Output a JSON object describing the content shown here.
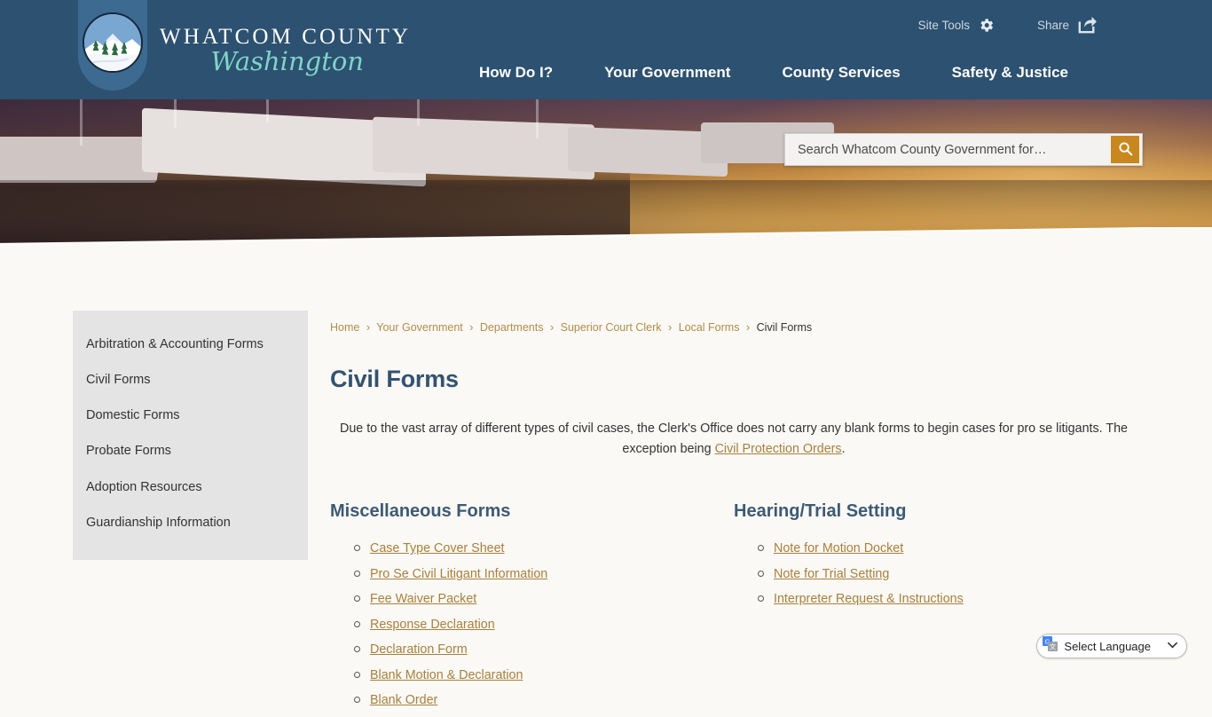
{
  "header": {
    "brand_line1": "WHATCOM COUNTY",
    "brand_line2": "Washington",
    "logo_icon": "whatcom-county-mountain-seal",
    "utility": [
      {
        "label": "Site Tools",
        "icon": "gear-icon"
      },
      {
        "label": "Share",
        "icon": "share-icon"
      }
    ],
    "nav": [
      {
        "label": "How Do I?"
      },
      {
        "label": "Your Government"
      },
      {
        "label": "County Services"
      },
      {
        "label": "Safety & Justice"
      }
    ],
    "colors": {
      "header_bg": "#2d5170",
      "logo_plate": "#3d6a91",
      "brand_accent": "#7fd4c8"
    }
  },
  "search": {
    "placeholder": "Search Whatcom County Government for…",
    "value": "",
    "button_icon": "search-icon",
    "button_color": "#c8881f"
  },
  "banner": {
    "alt": "marina-boats-at-sunset"
  },
  "sidebar": {
    "items": [
      {
        "label": "Arbitration & Accounting Forms"
      },
      {
        "label": "Civil Forms"
      },
      {
        "label": "Domestic Forms"
      },
      {
        "label": "Probate Forms"
      },
      {
        "label": "Adoption Resources"
      },
      {
        "label": "Guardianship Information"
      }
    ]
  },
  "breadcrumb": {
    "separator": "›",
    "items": [
      {
        "label": "Home",
        "current": false
      },
      {
        "label": "Your Government",
        "current": false
      },
      {
        "label": "Departments",
        "current": false
      },
      {
        "label": "Superior Court Clerk",
        "current": false
      },
      {
        "label": "Local Forms",
        "current": false
      },
      {
        "label": "Civil Forms",
        "current": true
      }
    ]
  },
  "main": {
    "title": "Civil Forms",
    "intro_before": "Due to the vast array of different types of civil cases, the Clerk's Office does not carry any blank forms to begin cases for pro se litigants. The exception being ",
    "intro_link": "Civil Protection Orders",
    "intro_after": ".",
    "columns": [
      {
        "title": "Miscellaneous Forms",
        "links": [
          "Case Type Cover Sheet",
          "Pro Se Civil Litigant Information",
          "Fee Waiver Packet",
          "Response Declaration",
          "Declaration Form",
          "Blank Motion & Declaration",
          "Blank Order"
        ]
      },
      {
        "title": "Hearing/Trial Setting",
        "links": [
          "Note for Motion Docket",
          "Note for Trial Setting",
          "Interpreter Request & Instructions"
        ]
      }
    ]
  },
  "language_widget": {
    "label": "Select Language",
    "icon": "google-translate-icon",
    "chevron": "⌄"
  }
}
